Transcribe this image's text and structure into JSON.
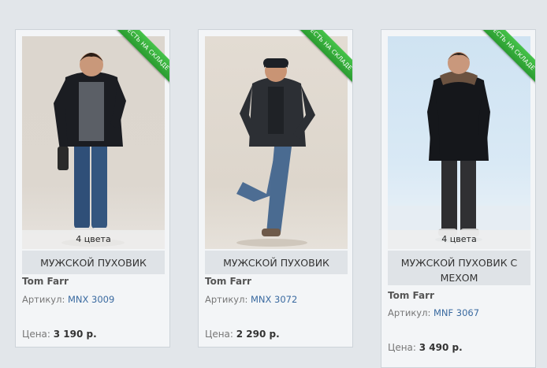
{
  "badge_text": "ЕСТЬ НА СКЛАДЕ",
  "price_label": "Цена:",
  "sku_label": "Артикул:",
  "products": [
    {
      "title": "МУЖСКОЙ ПУХОВИК",
      "brand": "Tom Farr",
      "sku": "MNX 3009",
      "price": "3 190 р.",
      "colors": "4 цвета"
    },
    {
      "title": "МУЖСКОЙ ПУХОВИК",
      "brand": "Tom Farr",
      "sku": "MNX 3072",
      "price": "2 290 р.",
      "colors": ""
    },
    {
      "title": "МУЖСКОЙ ПУХОВИК С МЕХОМ",
      "brand": "Tom Farr",
      "sku": "MNF 3067",
      "price": "3 490 р.",
      "colors": "4 цвета"
    }
  ],
  "colors": {
    "badge": "#2fa535",
    "sku_link": "#3a6aa0",
    "title_bar": "#dfe3e7",
    "background": "#e2e6ea"
  }
}
